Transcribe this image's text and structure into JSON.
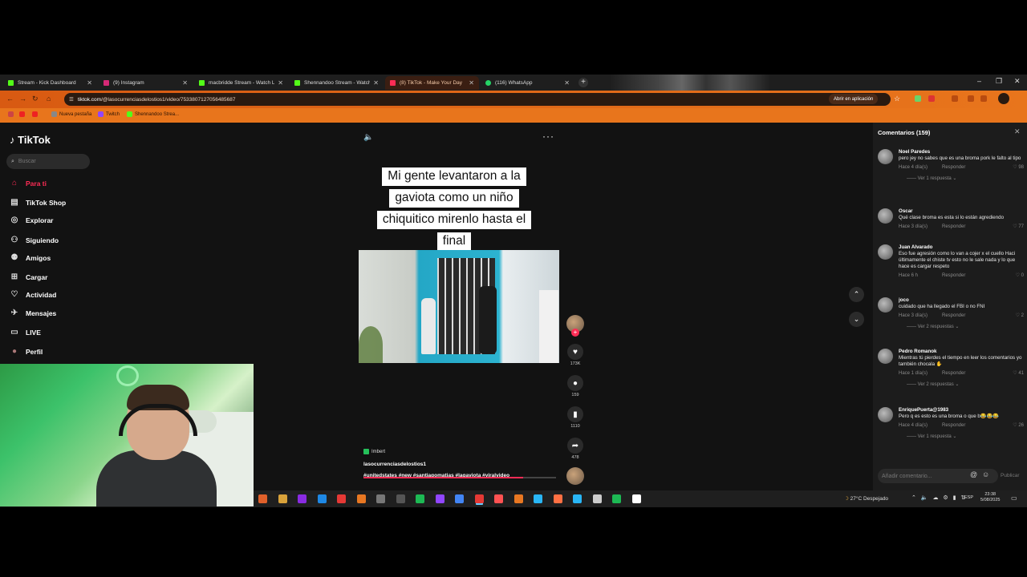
{
  "browser": {
    "tabs": [
      {
        "label": "Stream - Kick Dashboard",
        "color": "#53fc18"
      },
      {
        "label": "(9) Instagram",
        "color": "#d62976"
      },
      {
        "label": "macbridde Stream - Watch Liv",
        "color": "#53fc18"
      },
      {
        "label": "Shennandoo Stream - Watch Li",
        "color": "#53fc18"
      },
      {
        "label": "(8) TikTok - Make Your Day",
        "color": "#fe2c55"
      },
      {
        "label": "(116) WhatsApp",
        "color": "#25d366"
      }
    ],
    "new_tab": "+",
    "url_host": "tiktok.com",
    "url_path": "/@lasocurrenciasdelostios1/video/7533807127056485687",
    "open_in_app": "Abrir en aplicación",
    "bookmarks": [
      {
        "label": "Nueva pestaña",
        "color": "#888"
      },
      {
        "label": "Twitch",
        "color": "#9146ff"
      },
      {
        "label": "Shennandoo Strea...",
        "color": "#53fc18"
      }
    ],
    "window_controls": {
      "minimize": "–",
      "maximize": "❐",
      "close": "✕"
    }
  },
  "tiktok": {
    "logo": "TikTok",
    "search_placeholder": "Buscar",
    "nav": [
      {
        "label": "Para ti",
        "icon": "home-icon",
        "glyph": "⌂",
        "selected": true
      },
      {
        "label": "TikTok Shop",
        "icon": "shop-icon",
        "glyph": "▤"
      },
      {
        "label": "Explorar",
        "icon": "compass-icon",
        "glyph": "◎"
      },
      {
        "label": "Siguiendo",
        "icon": "following-icon",
        "glyph": "⚇"
      },
      {
        "label": "Amigos",
        "icon": "friends-icon",
        "glyph": "⚉"
      },
      {
        "label": "Cargar",
        "icon": "upload-icon",
        "glyph": "⊞"
      },
      {
        "label": "Actividad",
        "icon": "activity-icon",
        "glyph": "♡"
      },
      {
        "label": "Mensajes",
        "icon": "messages-icon",
        "glyph": "✈"
      },
      {
        "label": "LIVE",
        "icon": "live-icon",
        "glyph": "▭"
      },
      {
        "label": "Perfil",
        "icon": "profile-icon",
        "glyph": "●"
      }
    ],
    "video": {
      "caption_lines": [
        "Mi gente levantaron a la",
        "gaviota como un niño",
        "chiquitico mirenlo hasta el",
        "final"
      ],
      "more": "···",
      "likes": "173K",
      "comments": "159",
      "saves": "1110",
      "shares": "478",
      "location_tag": "Imbert",
      "username": "lasocurrenciasdelostios1",
      "hashtags": "#unitedstates #new #santiagomatias #lagaviota #viralvideo",
      "progress": 0.83
    },
    "comments_panel": {
      "title": "Comentarios (159)",
      "reply_label": "Responder",
      "input_placeholder": "Añadir comentario...",
      "post_label": "Publicar",
      "comments": [
        {
          "name": "Noel Paredes",
          "text": "pero jey no sabes que es una broma pork le falto al tipo",
          "time": "Hace 4 día(s)",
          "likes": "98",
          "replies": "Ver 1 respuesta"
        },
        {
          "name": "Oscar",
          "text": "Qué clase broma es esta si lo están agrediendo",
          "time": "Hace 3 día(s)",
          "likes": "77",
          "replies": ""
        },
        {
          "name": "Juan Alvarado",
          "text": "Eso fue agresión como lo van a cojer x el cuello Haci últimamente el chiste tv esto no le sale nada y lo que hace es cargar respeto",
          "time": "Hace 6 h",
          "likes": "0",
          "replies": ""
        },
        {
          "name": "joco",
          "text": "cuidado que ha llegado el FBI o no FNI",
          "time": "Hace 3 día(s)",
          "likes": "2",
          "replies": "Ver 2 respuestas"
        },
        {
          "name": "Pedro Romanok",
          "text": "Mientras tú pierdes el tiempo en leer los comentarios yo también chocala ✋",
          "time": "Hace 1 día(s)",
          "likes": "41",
          "replies": "Ver 2 respuestas"
        },
        {
          "name": "EnriquePuerta@1983",
          "text": "Pero q es esto es una broma o que b😂😂😂",
          "time": "Hace 4 día(s)",
          "likes": "26",
          "replies": "Ver 1 respuesta"
        }
      ]
    }
  },
  "taskbar": {
    "weather": "27°C Despejado",
    "lang": "ESP",
    "time": "23:38",
    "date": "5/08/2025",
    "icon_colors": [
      "#e0602a",
      "#d9a23a",
      "#8a2be2",
      "#1e88e5",
      "#e53935",
      "#e87722",
      "#777",
      "#555",
      "#1db954",
      "#9146ff",
      "#4285f4",
      "#e53935",
      "#ff5252",
      "#e87722",
      "#29b6f6",
      "#ff7043",
      "#29b6f6",
      "#ccc",
      "#1db954",
      "#fff"
    ]
  }
}
